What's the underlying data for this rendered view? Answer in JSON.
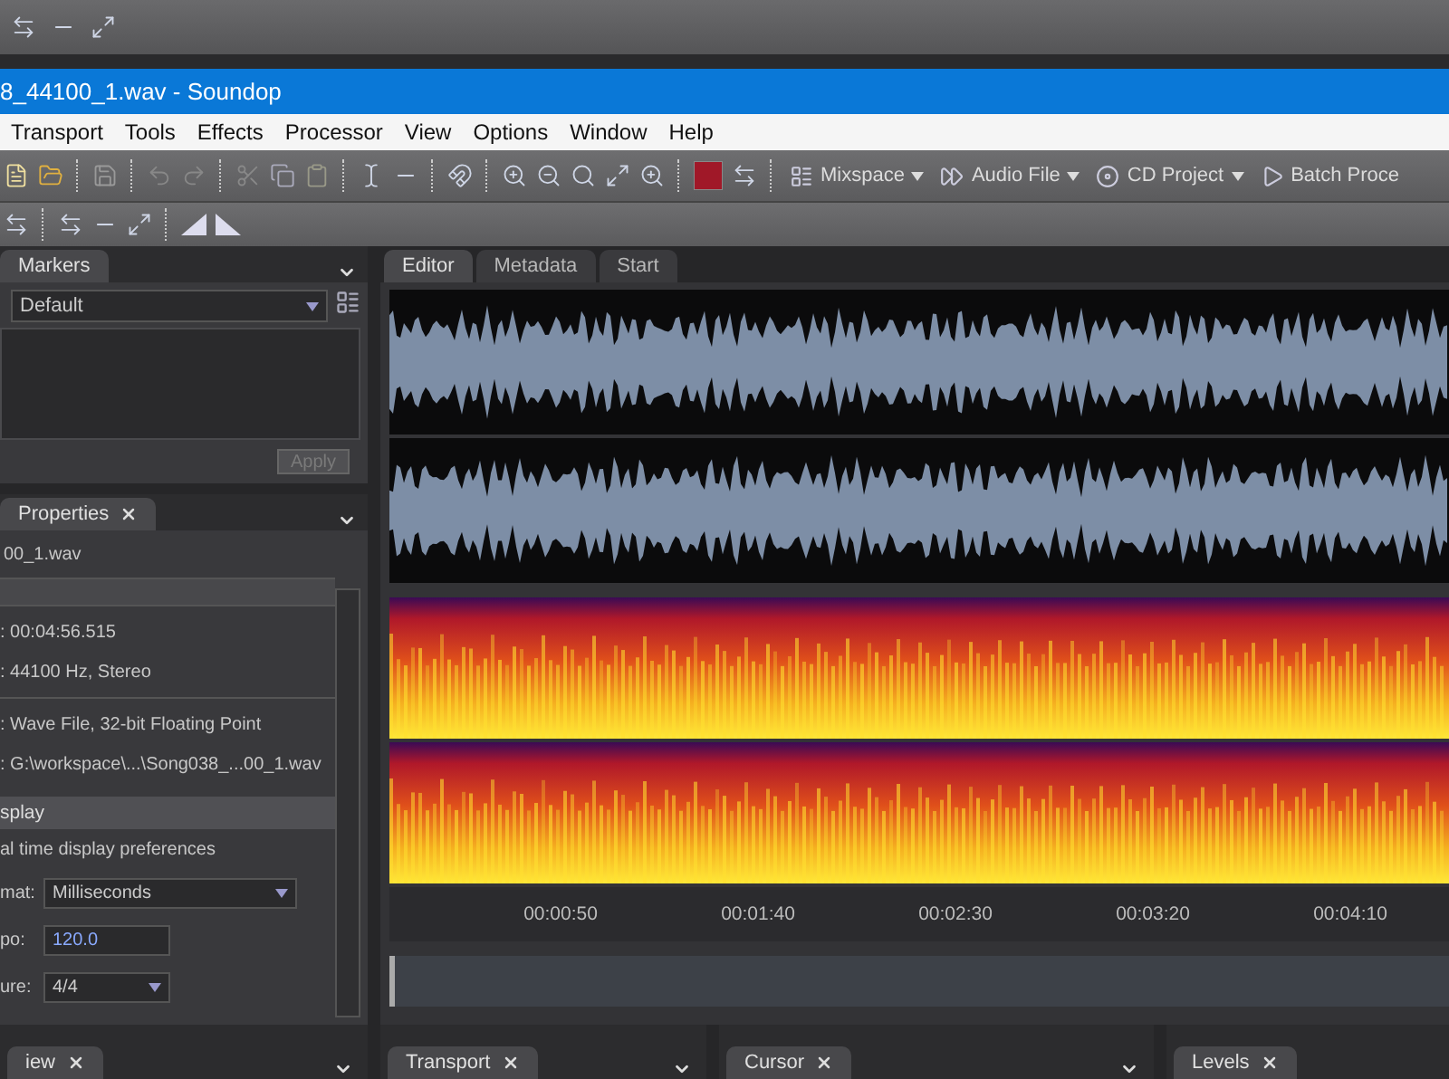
{
  "window": {
    "title": "8_44100_1.wav - Soundop"
  },
  "menu": [
    "Transport",
    "Tools",
    "Effects",
    "Processor",
    "View",
    "Options",
    "Window",
    "Help"
  ],
  "workspaces": [
    {
      "label": "Mixspace",
      "has_menu": true
    },
    {
      "label": "Audio File",
      "has_menu": true
    },
    {
      "label": "CD Project",
      "has_menu": true
    },
    {
      "label": "Batch Proce",
      "has_menu": false
    }
  ],
  "markers_panel": {
    "tab": "Markers",
    "preset": "Default",
    "apply": "Apply",
    "apply_disabled": true
  },
  "properties_panel": {
    "tab": "Properties",
    "file": "00_1.wav",
    "groups": [
      [
        ": 00:04:56.515",
        ": 44100 Hz, Stereo"
      ],
      [
        ": Wave File, 32-bit Floating Point",
        ": G:\\workspace\\...\\Song038_...00_1.wav"
      ]
    ],
    "section": "splay",
    "description": "al time display preferences",
    "fields": [
      {
        "kind": "dropdown",
        "label": "mat:",
        "value": "Milliseconds"
      },
      {
        "kind": "input",
        "label": "po:",
        "value": "120.0"
      },
      {
        "kind": "dropdown",
        "label": "ure:",
        "value": "4/4"
      }
    ]
  },
  "editor": {
    "tabs": [
      {
        "label": "Editor",
        "selected": true
      },
      {
        "label": "Metadata",
        "selected": false
      },
      {
        "label": "Start",
        "selected": false
      }
    ],
    "timeline": [
      "00:00:50",
      "00:01:40",
      "00:02:30",
      "00:03:20",
      "00:04:10"
    ]
  },
  "bottom_panels": [
    {
      "tab": "iew"
    },
    {
      "tab": "Transport"
    },
    {
      "tab": "Cursor"
    },
    {
      "tab": "Levels"
    }
  ]
}
